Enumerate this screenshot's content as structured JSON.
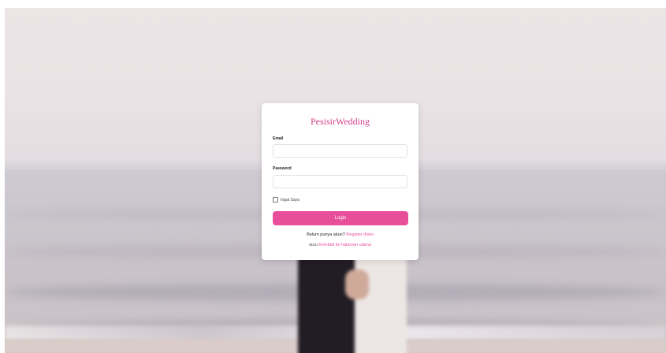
{
  "brand": "PesisirWedding",
  "form": {
    "email_label": "Email",
    "email_value": "",
    "password_label": "Password",
    "password_value": "",
    "remember_label": "Ingat Saya",
    "remember_checked": false,
    "login_button": "Login"
  },
  "footer": {
    "register_prompt": "Belum punya akun?",
    "register_link": "Register disini",
    "or_text": "atau",
    "home_link": "Kembali ke halaman utama"
  },
  "colors": {
    "accent": "#e84f9b",
    "brand": "#d53f8c"
  }
}
